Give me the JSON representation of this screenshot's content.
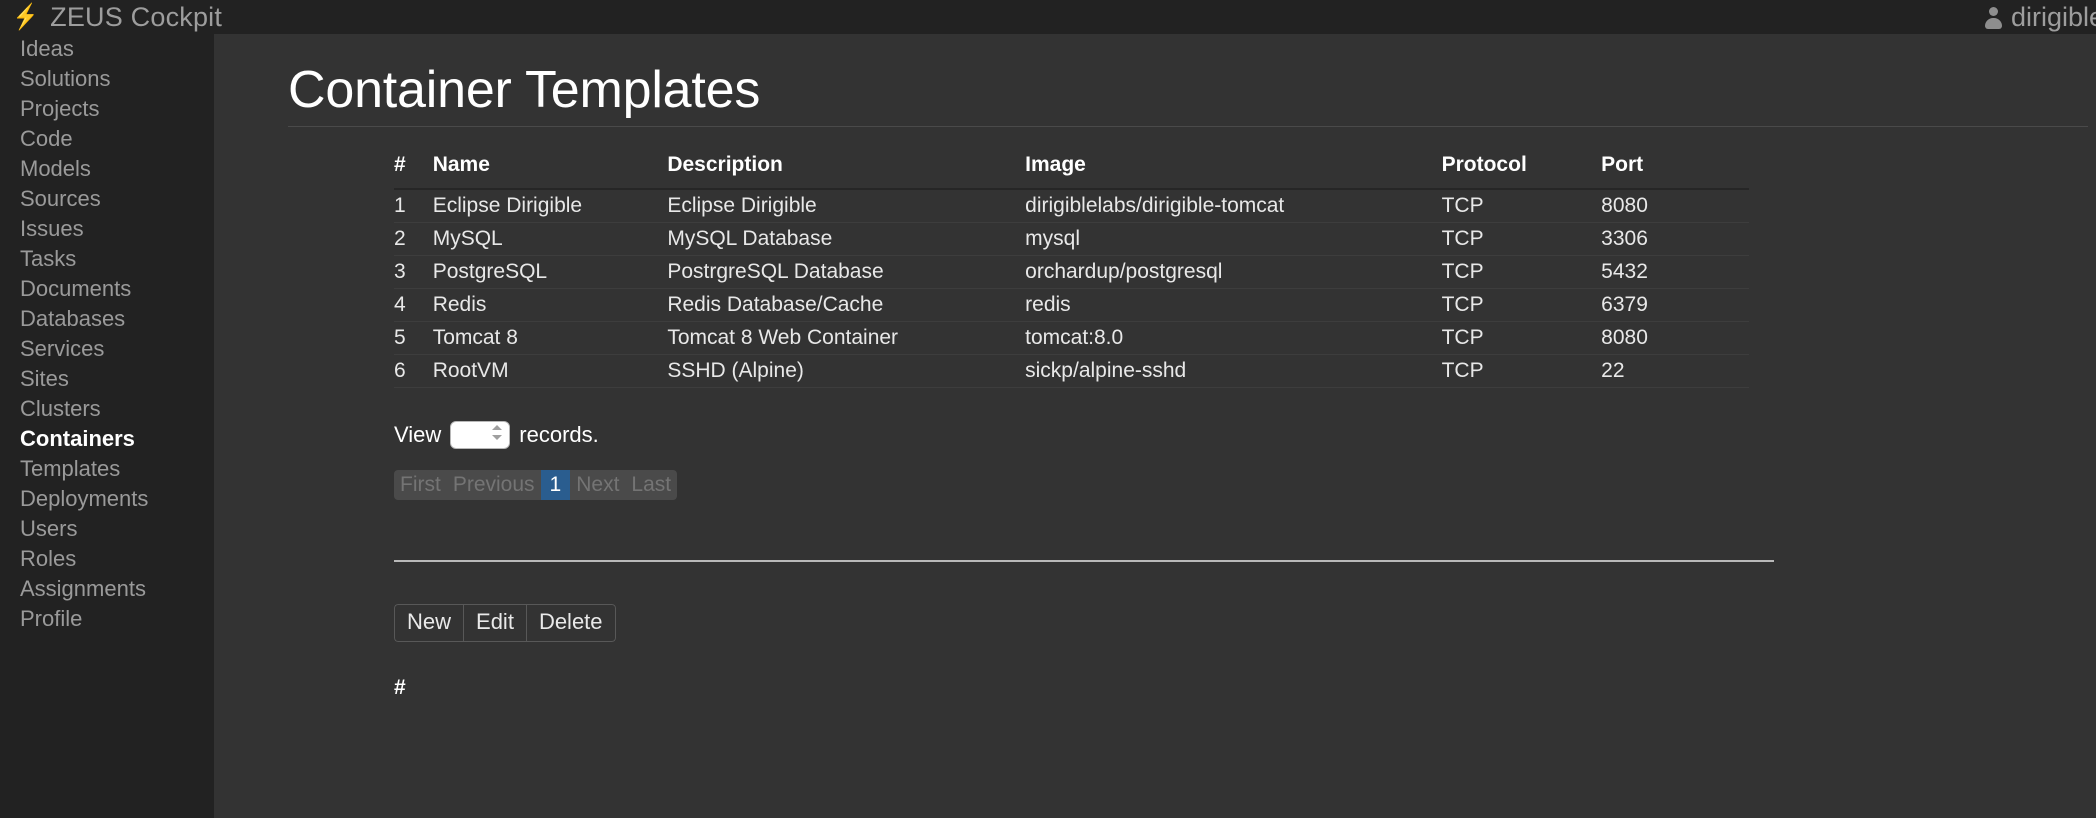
{
  "app": {
    "brand_icon": "bolt-icon",
    "brand_title": "ZEUS Cockpit",
    "user_icon": "user-icon",
    "user_name": "dirigible",
    "accent_color": "#2a5d8f",
    "bolt_color": "#f5f500",
    "sidebar_bg": "#222222",
    "content_bg": "#333333"
  },
  "sidebar": {
    "items": [
      {
        "label": "Ideas",
        "active": false
      },
      {
        "label": "Solutions",
        "active": false
      },
      {
        "label": "Projects",
        "active": false
      },
      {
        "label": "Code",
        "active": false
      },
      {
        "label": "Models",
        "active": false
      },
      {
        "label": "Sources",
        "active": false
      },
      {
        "label": "Issues",
        "active": false
      },
      {
        "label": "Tasks",
        "active": false
      },
      {
        "label": "Documents",
        "active": false
      },
      {
        "label": "Databases",
        "active": false
      },
      {
        "label": "Services",
        "active": false
      },
      {
        "label": "Sites",
        "active": false
      },
      {
        "label": "Clusters",
        "active": false
      },
      {
        "label": "Containers",
        "active": true
      },
      {
        "label": "Templates",
        "active": false
      },
      {
        "label": "Deployments",
        "active": false
      },
      {
        "label": "Users",
        "active": false
      },
      {
        "label": "Roles",
        "active": false
      },
      {
        "label": "Assignments",
        "active": false
      },
      {
        "label": "Profile",
        "active": false
      }
    ]
  },
  "main": {
    "page_title": "Container Templates",
    "table": {
      "columns": [
        "#",
        "Name",
        "Description",
        "Image",
        "Protocol",
        "Port"
      ],
      "rows": [
        {
          "num": "1",
          "name": "Eclipse Dirigible",
          "description": "Eclipse Dirigible",
          "image": "dirigiblelabs/dirigible-tomcat",
          "protocol": "TCP",
          "port": "8080"
        },
        {
          "num": "2",
          "name": "MySQL",
          "description": "MySQL Database",
          "image": "mysql",
          "protocol": "TCP",
          "port": "3306"
        },
        {
          "num": "3",
          "name": "PostgreSQL",
          "description": "PostrgreSQL Database",
          "image": "orchardup/postgresql",
          "protocol": "TCP",
          "port": "5432"
        },
        {
          "num": "4",
          "name": "Redis",
          "description": "Redis Database/Cache",
          "image": "redis",
          "protocol": "TCP",
          "port": "6379"
        },
        {
          "num": "5",
          "name": "Tomcat 8",
          "description": "Tomcat 8 Web Container",
          "image": "tomcat:8.0",
          "protocol": "TCP",
          "port": "8080"
        },
        {
          "num": "6",
          "name": "RootVM",
          "description": "SSHD (Alpine)",
          "image": "sickp/alpine-sshd",
          "protocol": "TCP",
          "port": "22"
        }
      ]
    },
    "view_records": {
      "prefix_label": "View",
      "suffix_label": "records.",
      "value": "",
      "placeholder": ""
    },
    "pagination": {
      "first": "First",
      "previous": "Previous",
      "current": "1",
      "next": "Next",
      "last": "Last"
    },
    "actions": {
      "new": "New",
      "edit": "Edit",
      "delete": "Delete"
    },
    "footer_hash": "#"
  }
}
